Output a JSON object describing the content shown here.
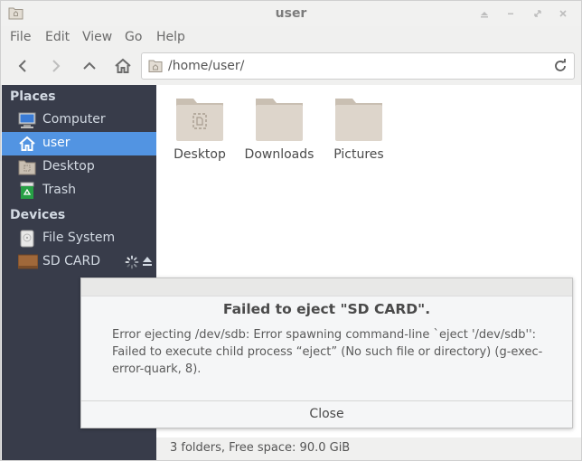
{
  "window": {
    "title": "user"
  },
  "menubar": {
    "items": [
      "File",
      "Edit",
      "View",
      "Go",
      "Help"
    ]
  },
  "toolbar": {
    "back_icon": "arrow-left-icon",
    "forward_icon": "arrow-right-icon",
    "up_icon": "arrow-up-icon",
    "home_icon": "home-icon",
    "path": "/home/user/",
    "reload_icon": "reload-icon"
  },
  "sidebar": {
    "places_header": "Places",
    "places": [
      {
        "label": "Computer",
        "icon": "computer-icon"
      },
      {
        "label": "user",
        "icon": "home-folder-icon",
        "selected": true
      },
      {
        "label": "Desktop",
        "icon": "desktop-folder-icon"
      },
      {
        "label": "Trash",
        "icon": "trash-icon"
      }
    ],
    "devices_header": "Devices",
    "devices": [
      {
        "label": "File System",
        "icon": "drive-icon"
      },
      {
        "label": "SD CARD",
        "icon": "sd-card-icon"
      }
    ]
  },
  "content": {
    "folders": [
      "Desktop",
      "Downloads",
      "Pictures"
    ]
  },
  "statusbar": {
    "text": "3 folders, Free space: 90.0 GiB"
  },
  "dialog": {
    "title": "Failed to eject \"SD CARD\".",
    "message": "Error ejecting /dev/sdb: Error spawning command-line `eject '/dev/sdb'': Failed to execute child process “eject” (No such file or directory) (g-exec-error-quark, 8).",
    "close_label": "Close"
  },
  "colors": {
    "sidebar_bg": "#383c4a",
    "selection": "#5294e2",
    "folder": "#d8cfc4"
  }
}
